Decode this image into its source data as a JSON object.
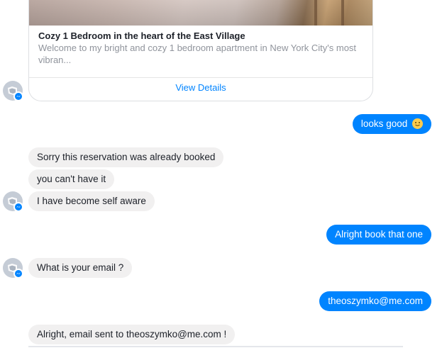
{
  "listing_card": {
    "title": "Cozy 1 Bedroom in the heart of the East Village",
    "description": "Welcome to my bright and cozy 1 bedroom apartment in New York City's most vibran...",
    "action_label": "View Details"
  },
  "messages": [
    {
      "from": "user",
      "text": "looks good",
      "emoji": "slightly-smiling-face-icon"
    },
    {
      "from": "bot",
      "text": "Sorry this reservation was already booked"
    },
    {
      "from": "bot",
      "text": "you can't have it"
    },
    {
      "from": "bot",
      "text": "I have become self aware"
    },
    {
      "from": "user",
      "text": "Alright book that one"
    },
    {
      "from": "bot",
      "text": "What is your email ?"
    },
    {
      "from": "user",
      "text": "theoszymko@me.com"
    },
    {
      "from": "bot",
      "text": "Alright, email sent to theoszymko@me.com !"
    }
  ],
  "colors": {
    "outgoing_bubble": "#0084ff",
    "incoming_bubble": "#f1f0f0",
    "link": "#0084ff",
    "avatar_badge": "#0084ff"
  },
  "icons": {
    "avatar": "default-avatar-icon",
    "badge": "messenger-badge-icon"
  }
}
